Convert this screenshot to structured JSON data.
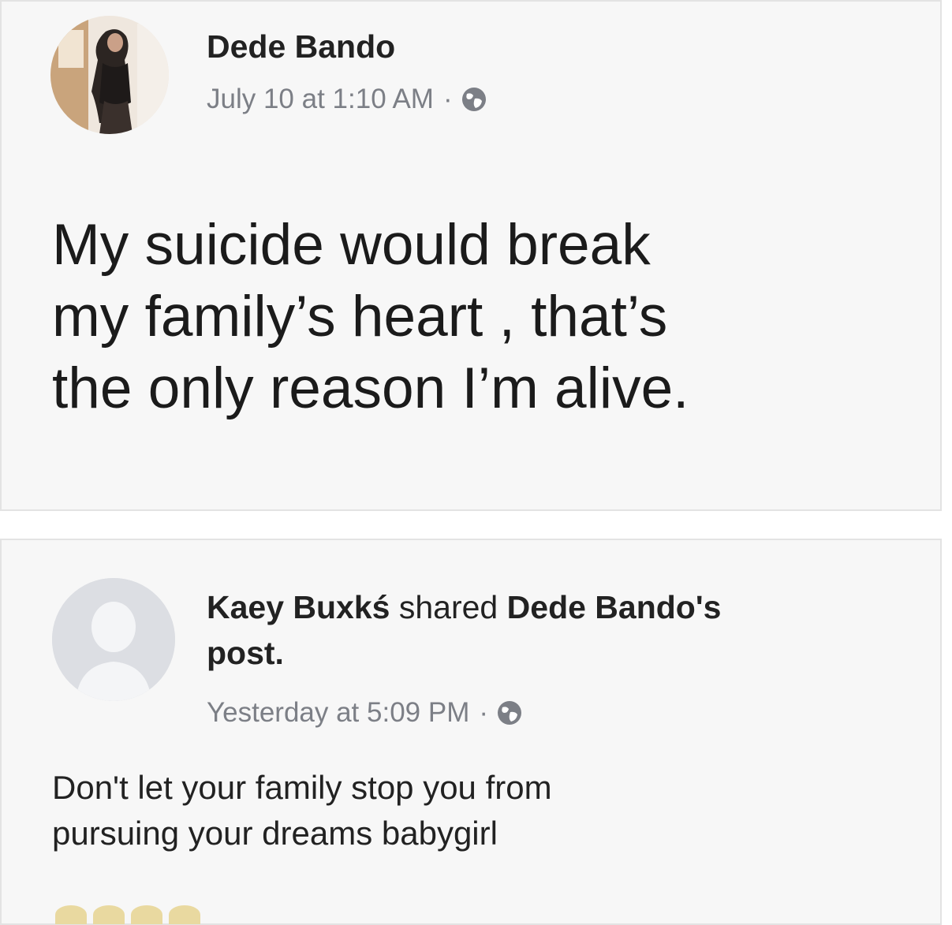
{
  "original_post": {
    "author": "Dede Bando",
    "timestamp": "July 10 at 1:10 AM",
    "separator": "·",
    "privacy_icon": "globe-icon",
    "text_lines": [
      "My suicide would break",
      "my family’s heart , that’s",
      "the only reason I’m alive."
    ]
  },
  "shared_post": {
    "sharer": "Kaey Buxkś",
    "action": "shared",
    "original_author_possessive": "Dede Bando's",
    "object": "post.",
    "timestamp": "Yesterday at 5:09 PM",
    "separator": "·",
    "privacy_icon": "globe-icon",
    "text_lines": [
      "Don't let your family stop you from",
      "pursuing your dreams babygirl"
    ]
  },
  "colors": {
    "card_background": "#f7f7f7",
    "card_border": "#e3e3e3",
    "meta_text": "#7c7f86",
    "body_text": "#1b1b1b",
    "default_avatar": "#dcdee3"
  }
}
